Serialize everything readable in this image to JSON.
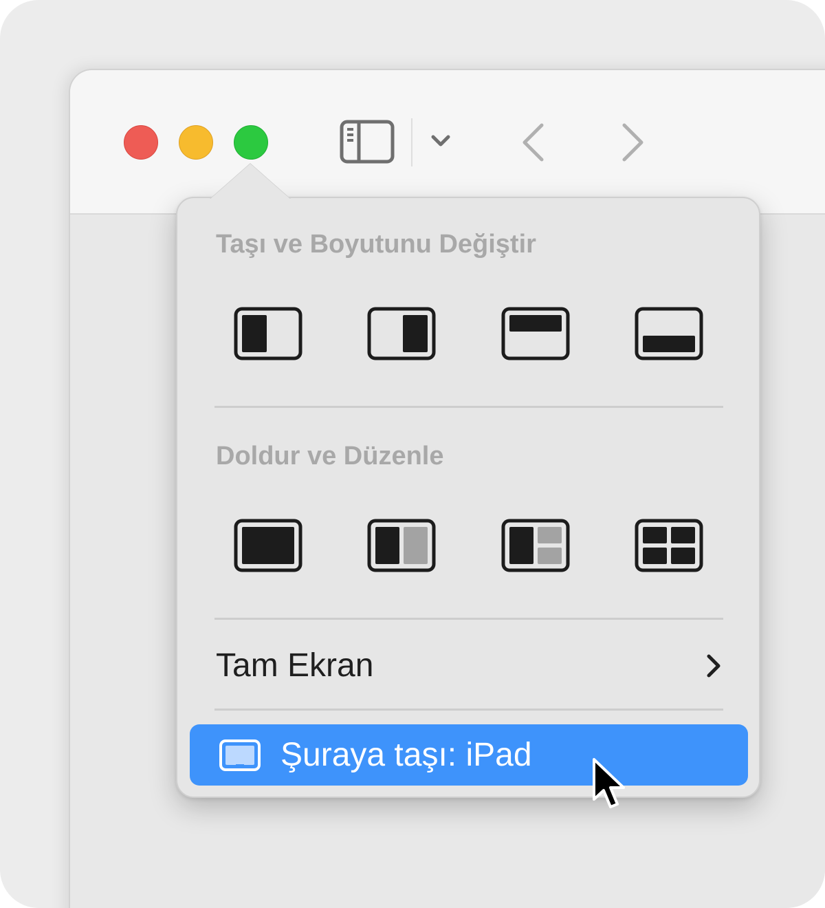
{
  "window": {
    "traffic_lights": [
      {
        "name": "close",
        "color": "#ee5c55"
      },
      {
        "name": "minimize",
        "color": "#f7bb2e"
      },
      {
        "name": "zoom",
        "color": "#2cc940"
      }
    ],
    "toolbar_icons": [
      "sidebar-icon",
      "chevron-down-icon",
      "back-chevron-icon",
      "forward-chevron-icon"
    ]
  },
  "popover": {
    "section_move_resize": "Taşı ve Boyutunu Değiştir",
    "move_resize_options": [
      "left-half-icon",
      "right-half-icon",
      "top-half-icon",
      "bottom-half-icon"
    ],
    "section_fill_arrange": "Doldur ve Düzenle",
    "fill_arrange_options": [
      "fill-icon",
      "split-two-icon",
      "split-three-icon",
      "quarters-icon"
    ],
    "full_screen_label": "Tam Ekran",
    "move_to_label": "Şuraya taşı: iPad",
    "highlight_color": "#3e93fb"
  }
}
